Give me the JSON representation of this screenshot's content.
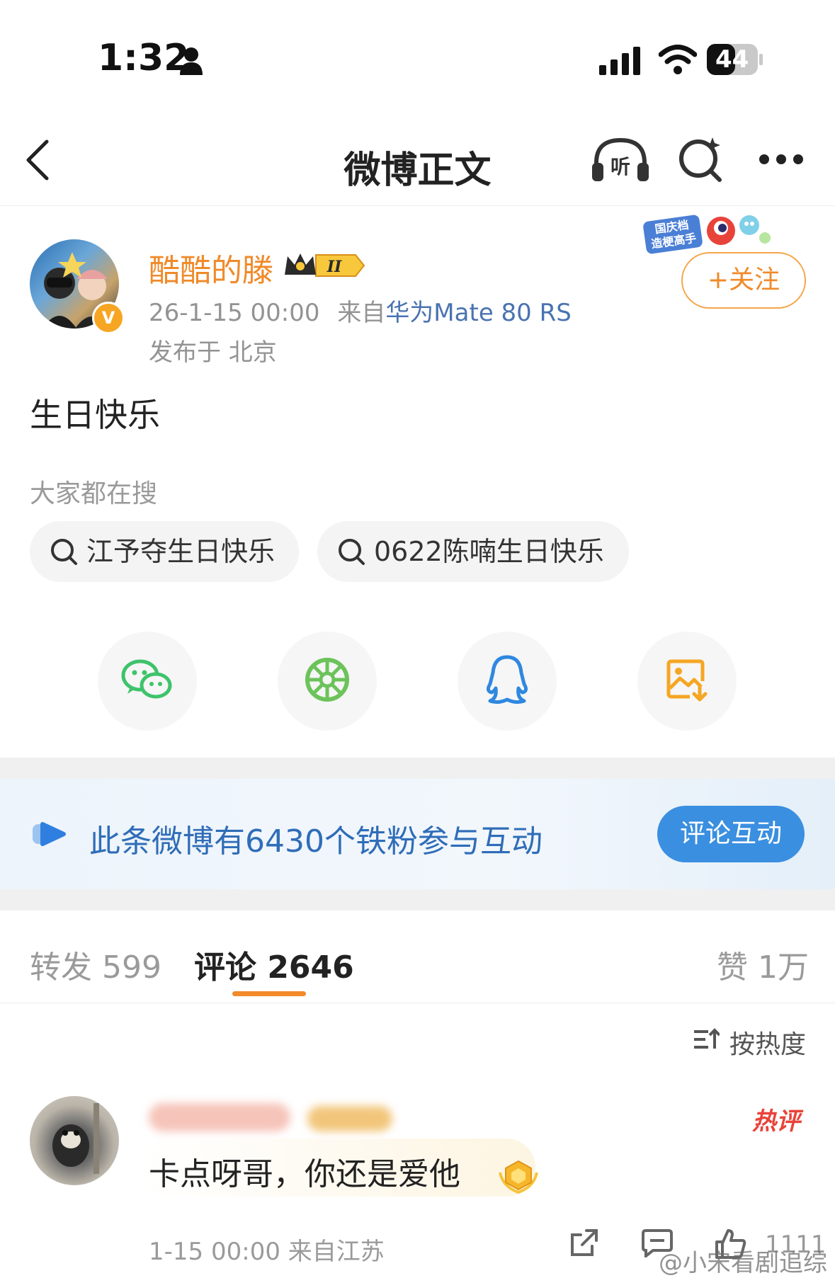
{
  "status_bar": {
    "time": "1:32",
    "battery": "44"
  },
  "nav": {
    "title": "微博正文"
  },
  "author": {
    "name": "酷酷的滕",
    "level_badge": "II",
    "verified_badge": "V",
    "time": "26-1-15 00:00",
    "source_prefix": "来自",
    "device": "华为Mate 80 RS",
    "location": "发布于 北京",
    "promo_sticker": "国庆档 造梗高手",
    "follow_label": "+关注"
  },
  "post": {
    "text": "生日快乐"
  },
  "search": {
    "heading": "大家都在搜",
    "chips": [
      "江予夺生日快乐",
      "0622陈喃生日快乐"
    ]
  },
  "share": {
    "icons": [
      "wechat-icon",
      "moments-icon",
      "qq-icon",
      "save-image-icon"
    ]
  },
  "banner": {
    "text": "此条微博有6430个铁粉参与互动",
    "button": "评论互动"
  },
  "tabs": {
    "repost": "转发 599",
    "comment": "评论 2646",
    "like": "赞 1万"
  },
  "sort": {
    "label": "按热度"
  },
  "comment": {
    "hot_badge": "热评",
    "text": "卡点呀哥，你还是爱他",
    "meta": "1-15 00:00 来自江苏",
    "likes": "1111"
  },
  "watermark": "@小宋看剧追综",
  "colors": {
    "accent": "#f08a2a",
    "link": "#4a73b0",
    "banner_button": "#3a8fe0",
    "hot": "#e8433a"
  }
}
